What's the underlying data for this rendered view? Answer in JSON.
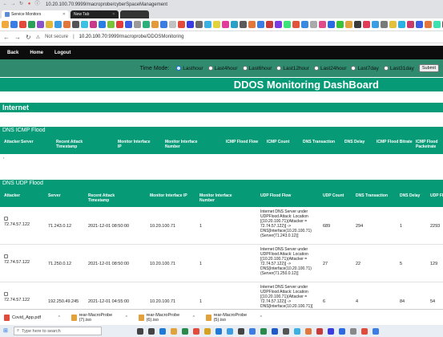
{
  "browser": {
    "top_url": "10.20.100.70:9999/macroprobe/cyberSpaceManagement",
    "tabs": [
      {
        "label": "Service Monitors"
      },
      {
        "label": "New Tab"
      },
      {
        "label": ""
      }
    ],
    "address": {
      "security": "Not secure",
      "url_host": "10.20.100.70",
      "url_path": ":9999/macroprobe/DDOSMonitoring"
    },
    "bookmark_colors": [
      "#f2a93b",
      "#3b7de2",
      "#e24b3b",
      "#2aa05a",
      "#8a53c9",
      "#e2b83b",
      "#3b9ee2",
      "#e2773b",
      "#555555",
      "#3bc2e2",
      "#c93b8a",
      "#2a7de2",
      "#7bc23b",
      "#e23b3b",
      "#3b5ee2",
      "#9a9a9a",
      "#2ab07a",
      "#e29a3b",
      "#3b7de2",
      "#c2c2c2",
      "#e24b3b",
      "#3b3be2",
      "#6a6a6a",
      "#3bb0e2",
      "#e2d23b",
      "#e23b9a",
      "#2aa0c9",
      "#5a5a5a",
      "#e2773b",
      "#3b7de2",
      "#c93b3b",
      "#7a3be2",
      "#3be27a",
      "#e2553b",
      "#3b8ae2",
      "#aaaaaa",
      "#e24b8a",
      "#2a6ae2",
      "#3bc23b",
      "#e2a23b",
      "#3b3b3b",
      "#e23b5a",
      "#3b9ee2",
      "#7a7a7a",
      "#e2c23b",
      "#2ab0e2",
      "#c93b6a",
      "#3b5ee2",
      "#e2773b",
      "#3be2b0",
      "#555555",
      "#e24b3b",
      "#3b7de2",
      "#cc0000"
    ]
  },
  "app": {
    "nav": [
      "Back",
      "Home",
      "Logout"
    ],
    "time_mode_label": "Time Mode:",
    "time_options": [
      "Lasthour",
      "Last4hour",
      "Last6hour",
      "Last12hour",
      "Last24hour",
      "Last7day",
      "Last31day"
    ],
    "selected_time_option": "Lasthour",
    "submit_label": "Submit",
    "page_title": "DDOS Monitoring DashBoard",
    "internet_label": "Internet",
    "icmp": {
      "title": "DNS ICMP Flood",
      "headers": [
        "Attacker",
        "Server",
        "Recent Attack Timestamp",
        "Monitor Interface IP",
        "Monitor Interface Number",
        "ICMP Flood Flow",
        "ICMP Count",
        "DNS Transaction",
        "DNS Delay",
        "ICMP Flood Bitrate",
        "ICMP Flood Packetrate"
      ],
      "empty_mark": ","
    },
    "udp": {
      "title": "DNS UDP Flood",
      "headers": [
        "Attacker",
        "Server",
        "Recent Attack Timestamp",
        "Monitor Interface IP",
        "Monitor Interface Number",
        "UDP Flood Flow",
        "UDP Count",
        "DNS Transaction",
        "DNS Delay",
        "UDP Flood Bitrate"
      ],
      "rows": [
        {
          "attacker": "72.74.57.122",
          "server": "71.243.0.12",
          "timestamp": "2021-12-01 08:50:00",
          "iface_ip": "10.20.100.71",
          "iface_num": "1",
          "flow": "Internet DNS Server under UDPFlood Attack: Location [(10.20.100.71)(Attacker = 72.74.57.122)] -> DNS[Interface(10.20.100.71)(Server(71.243.0.12)]",
          "count": "689",
          "transaction": "294",
          "delay": "1",
          "bitrate": "2293"
        },
        {
          "attacker": "72.74.57.122",
          "server": "71.250.0.12",
          "timestamp": "2021-12-01 08:50:00",
          "iface_ip": "10.20.100.71",
          "iface_num": "1",
          "flow": "Internet DNS Server under UDPFlood Attack: Location [(10.20.100.71)(Attacker = 72.74.57.122)] -> DNS[Interface(10.20.100.71)(Server(71.250.0.12)]",
          "count": "27",
          "transaction": "22",
          "delay": "5",
          "bitrate": "129"
        },
        {
          "attacker": "72.74.57.122",
          "server": "192.250.49.245",
          "timestamp": "2021-12-01 04:55:00",
          "iface_ip": "10.20.100.71",
          "iface_num": "1",
          "flow": "Internet DNS Server under UDPFlood Attack: Location [(10.20.100.71)(Attacker = 72.74.57.122)] -> DNS[Interface(10.20.100.71)]",
          "count": "6",
          "transaction": "4",
          "delay": "84",
          "bitrate": "54"
        }
      ]
    }
  },
  "downloads": [
    "Covid_App.pdf",
    "rear-MacroProbe (7).iso",
    "rear-MacroProbe (6).iso",
    "rear-MacroProbe (5).iso"
  ],
  "taskbar": {
    "search_placeholder": "Type here to search",
    "icon_colors": [
      "#444444",
      "#444444",
      "#1e7ad6",
      "#e2a23b",
      "#2a8a4a",
      "#e24b3b",
      "#d6a21e",
      "#1e7ad6",
      "#3b9ee2",
      "#444444",
      "#3b7de2",
      "#2a8a4a",
      "#1e5ac9",
      "#555555",
      "#3bb0e2",
      "#e2773b",
      "#c93b3b",
      "#3b3be2",
      "#2a6ae2",
      "#888888",
      "#e24b3b",
      "#3b7de2"
    ]
  }
}
